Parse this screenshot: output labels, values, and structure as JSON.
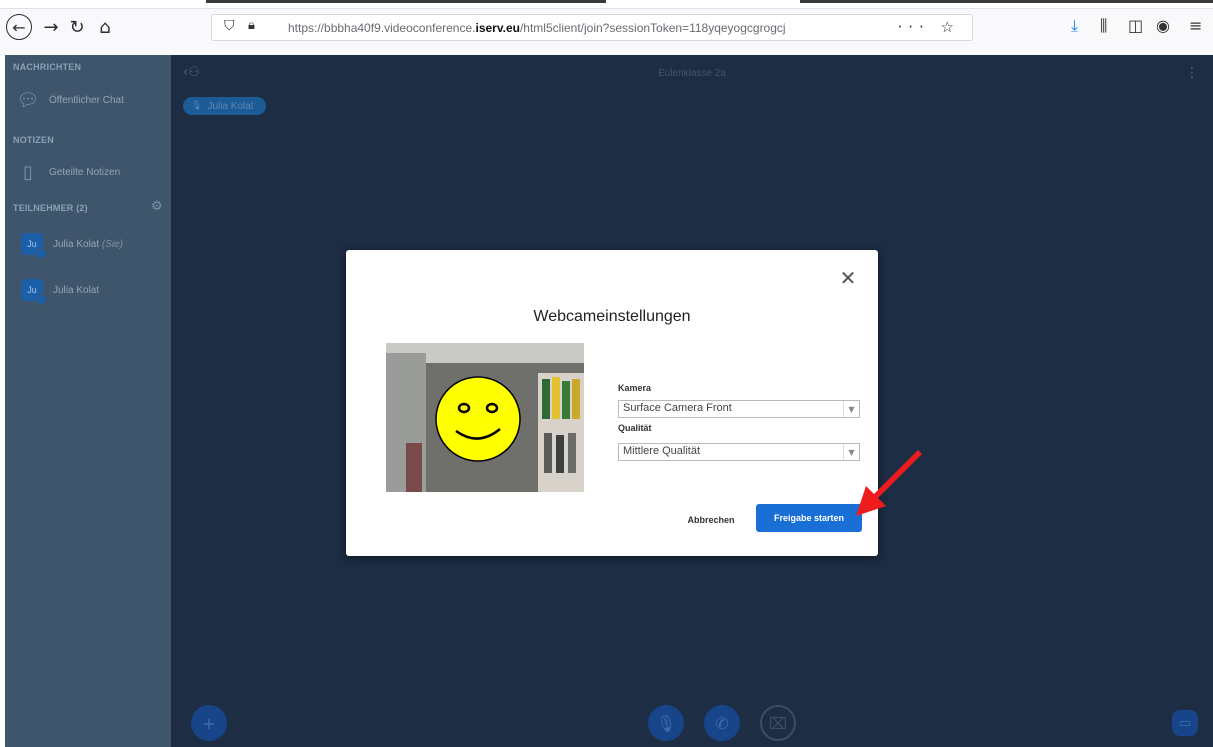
{
  "browser": {
    "url_prefix": "https://bbbha40f9.videoconference.",
    "url_domain": "iserv.eu",
    "url_suffix": "/html5client/join?sessionToken=118yqeyogcgrogcj",
    "url_actions": "··· ☆",
    "icons": [
      "back-icon",
      "forward-icon",
      "reload-icon",
      "home-icon",
      "shield-icon",
      "lock-icon",
      "download-icon",
      "library-icon",
      "sidebar-icon",
      "account-icon",
      "menu-icon"
    ]
  },
  "sidebar": {
    "messages_heading": "NACHRICHTEN",
    "public_chat": "Öffentlicher Chat",
    "notes_heading": "NOTIZEN",
    "shared_notes": "Geteilte Notizen",
    "participants_heading": "TEILNEHMER (2)",
    "participants": [
      {
        "initials": "Ju",
        "name": "Julia Kolat",
        "suffix": "(Sie)"
      },
      {
        "initials": "Ju",
        "name": "Julia Kolat",
        "suffix": ""
      }
    ]
  },
  "main": {
    "title": "Eulenklasse 2a",
    "talker": "Julia Kolat"
  },
  "modal": {
    "title": "Webcameinstellungen",
    "camera_label": "Kamera",
    "camera_value": "Surface Camera Front",
    "quality_label": "Qualität",
    "quality_value": "Mittlere Qualität",
    "cancel_label": "Abbrechen",
    "share_label": "Freigabe starten"
  },
  "colors": {
    "sidebar": "#3f556b",
    "main": "#1d2d44",
    "primary_button": "#1a6fd6",
    "arrow": "#ee1c1c",
    "smiley": "#ffff00"
  }
}
